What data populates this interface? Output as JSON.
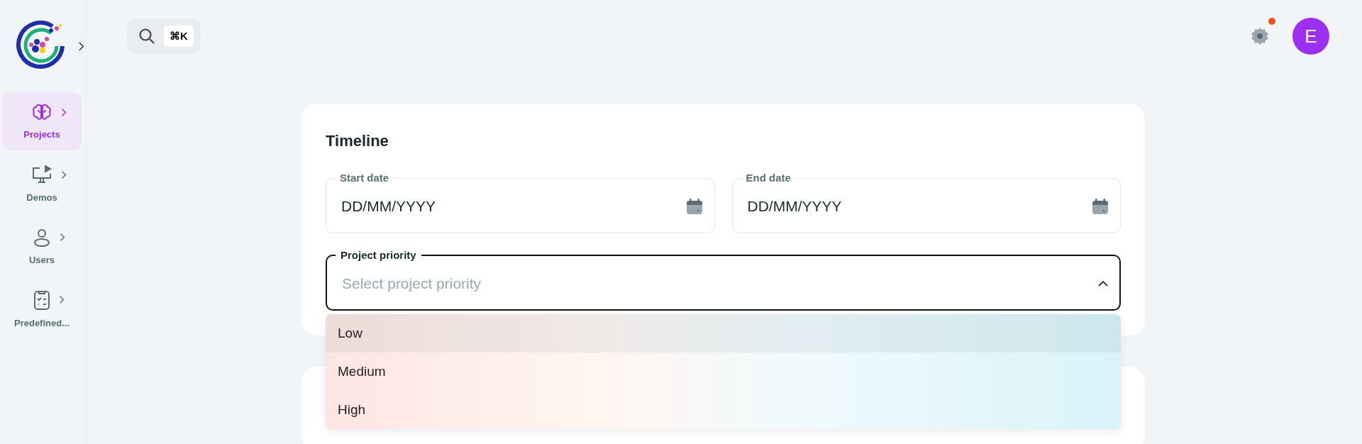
{
  "sidebar": {
    "items": [
      {
        "label": "Projects",
        "selected": true
      },
      {
        "label": "Demos",
        "selected": false
      },
      {
        "label": "Users",
        "selected": false
      },
      {
        "label": "Predefined...",
        "selected": false
      }
    ]
  },
  "search": {
    "shortcut": "⌘K"
  },
  "settings": {
    "has_notification": true
  },
  "avatar": {
    "initial": "E"
  },
  "card": {
    "title": "Timeline",
    "start_date": {
      "label": "Start date",
      "placeholder": "DD/MM/YYYY"
    },
    "end_date": {
      "label": "End date",
      "placeholder": "DD/MM/YYYY"
    },
    "priority": {
      "label": "Project priority",
      "placeholder": "Select project priority",
      "focused": true,
      "expanded": true,
      "options": [
        {
          "label": "Low",
          "selected": true
        },
        {
          "label": "Medium",
          "selected": false
        },
        {
          "label": "High",
          "selected": false
        }
      ]
    }
  }
}
